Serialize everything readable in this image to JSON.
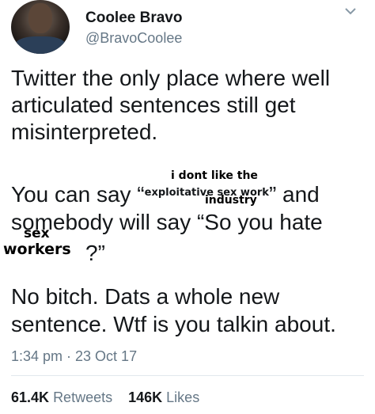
{
  "user": {
    "name": "Coolee Bravo",
    "handle": "@BravoCoolee"
  },
  "tweet": {
    "lines": [
      "Twitter the only place where well",
      "articulated sentences still get",
      "misinterpreted.",
      "You can say “",
      "” and",
      "somebody will say “So you hate",
      "?”",
      "No bitch. Dats a whole new",
      "sentence. Wtf is you talkin about."
    ],
    "inline_phrase": "exploitative sex work",
    "overlays": {
      "top": "i dont like the",
      "bottom": "industry",
      "sex": "sex",
      "workers": "workers"
    }
  },
  "meta": {
    "time": "1:34 pm · 23 Oct 17"
  },
  "stats": {
    "retweets_count": "61.4K",
    "retweets_label": "Retweets",
    "likes_count": "146K",
    "likes_label": "Likes"
  },
  "icons": {
    "menu": "chevron-down-icon",
    "avatar": "avatar"
  }
}
